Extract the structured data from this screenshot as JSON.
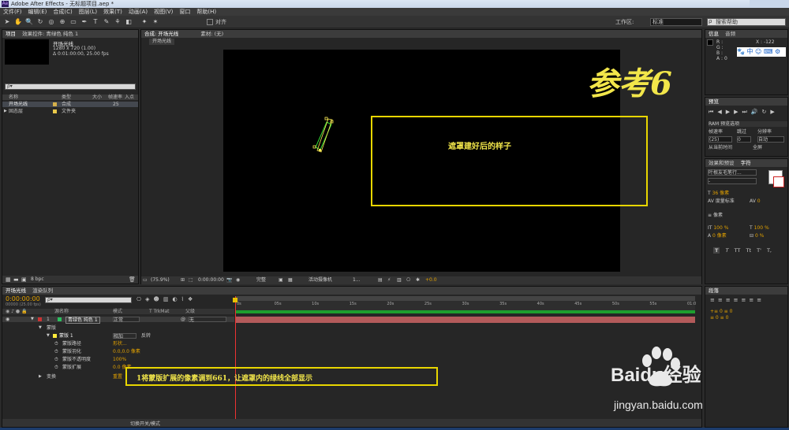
{
  "window": {
    "title": "Adobe After Effects - 无标题项目.aep *"
  },
  "menu": [
    "文件(F)",
    "编辑(E)",
    "合成(C)",
    "图层(L)",
    "效果(T)",
    "动画(A)",
    "视图(V)",
    "窗口",
    "帮助(H)"
  ],
  "toolbar": {
    "align_label": "对齐",
    "workspace_label": "工作区:",
    "workspace_value": "标准",
    "search_placeholder": "搜索帮助"
  },
  "project_panel": {
    "tabs": [
      "项目",
      "效果控件: 青绿色 纯色 1"
    ],
    "comp_name": "开场光线",
    "comp_info1": "1280 x 720 (1.00)",
    "comp_info2": "Δ 0:01:00:00, 25.00 fps",
    "search_placeholder": "ρ▾",
    "columns": [
      "名称",
      "类型",
      "大小",
      "帧速率",
      "入点"
    ],
    "items": [
      {
        "name": "开场光线",
        "type": "合成",
        "fps": "25",
        "color": "#d4b04a"
      },
      {
        "name": "固态层",
        "type": "文件夹",
        "fps": "",
        "color": "#e8c84a"
      }
    ],
    "bpc": "8 bpc"
  },
  "comp_panel": {
    "tabs": [
      "合成: 开场光线",
      "素材: (无)"
    ],
    "breadcrumb": "开场光线",
    "zoom": "(75.9%)",
    "timecode": "0:00:00:00",
    "resolution": "完整",
    "camera": "活动摄像机",
    "views": "1...",
    "exposure": "+0.0"
  },
  "info_panel": {
    "tabs": [
      "信息",
      "音频"
    ],
    "r": "R :",
    "g": "G :",
    "b": "B :",
    "a": "A : 0",
    "x": "X : -122",
    "y": "Y : 661"
  },
  "preview_panel": {
    "tab": "预览",
    "ram": "RAM 预览选项",
    "frame_rate_label": "帧速率",
    "skip_label": "跳过",
    "resolution_label": "分辨率",
    "frame_rate": "(25)",
    "skip": "0",
    "resolution": "自动",
    "from_current": "从当前时间",
    "fullscreen": "全屏"
  },
  "char_panel": {
    "tabs": [
      "效果和预设",
      "字符"
    ],
    "font": "叶根友毛笔行...",
    "style": "-",
    "size": "36 像素",
    "kerning": "0",
    "leading_label": "度量标准",
    "px_label": "像素",
    "scale_v": "100 %",
    "scale_h": "100 %",
    "baseline": "0 像素",
    "tsume": "0 %",
    "styles": [
      "T",
      "T",
      "TT",
      "Tt",
      "T'",
      "T,"
    ]
  },
  "tracker_panel": {
    "tab": "段落"
  },
  "timeline": {
    "tabs": [
      "开场光线",
      "渲染队列"
    ],
    "timecode": "0:00:00:00",
    "timecode_sub": "00000 (25.00 fps)",
    "search_placeholder": "ρ▾",
    "headers": [
      "源名称",
      "模式",
      "T TrkMat",
      "父级"
    ],
    "ruler": [
      "0s",
      "05s",
      "10s",
      "15s",
      "20s",
      "25s",
      "30s",
      "35s",
      "40s",
      "45s",
      "50s",
      "55s",
      "01:0"
    ],
    "layer": {
      "num": "1",
      "name": "青绿色 纯色 1",
      "mode": "正常",
      "parent": "无"
    },
    "props": [
      {
        "name": "蒙版",
        "value": "",
        "indent": 1
      },
      {
        "name": "蒙版 1",
        "value": "相加",
        "extra": "反转",
        "indent": 2
      },
      {
        "name": "蒙版路径",
        "value": "形状...",
        "indent": 3
      },
      {
        "name": "蒙版羽化",
        "value": "0.0,0.0 像素",
        "indent": 3
      },
      {
        "name": "蒙版不透明度",
        "value": "100%",
        "indent": 3
      },
      {
        "name": "蒙版扩展",
        "value": "0.0 像素",
        "indent": 3
      },
      {
        "name": "变换",
        "value": "重置",
        "indent": 1
      }
    ],
    "bottom_label": "切换开关/模式"
  },
  "annotations": {
    "ref_title": "参考6",
    "mask_note": "遮罩建好后的样子",
    "step_note": "1将蒙版扩展的像素调到661，让遮罩内的绿线全部显示"
  },
  "watermark": {
    "text": "Baidu经验",
    "url": "jingyan.baidu.com"
  }
}
